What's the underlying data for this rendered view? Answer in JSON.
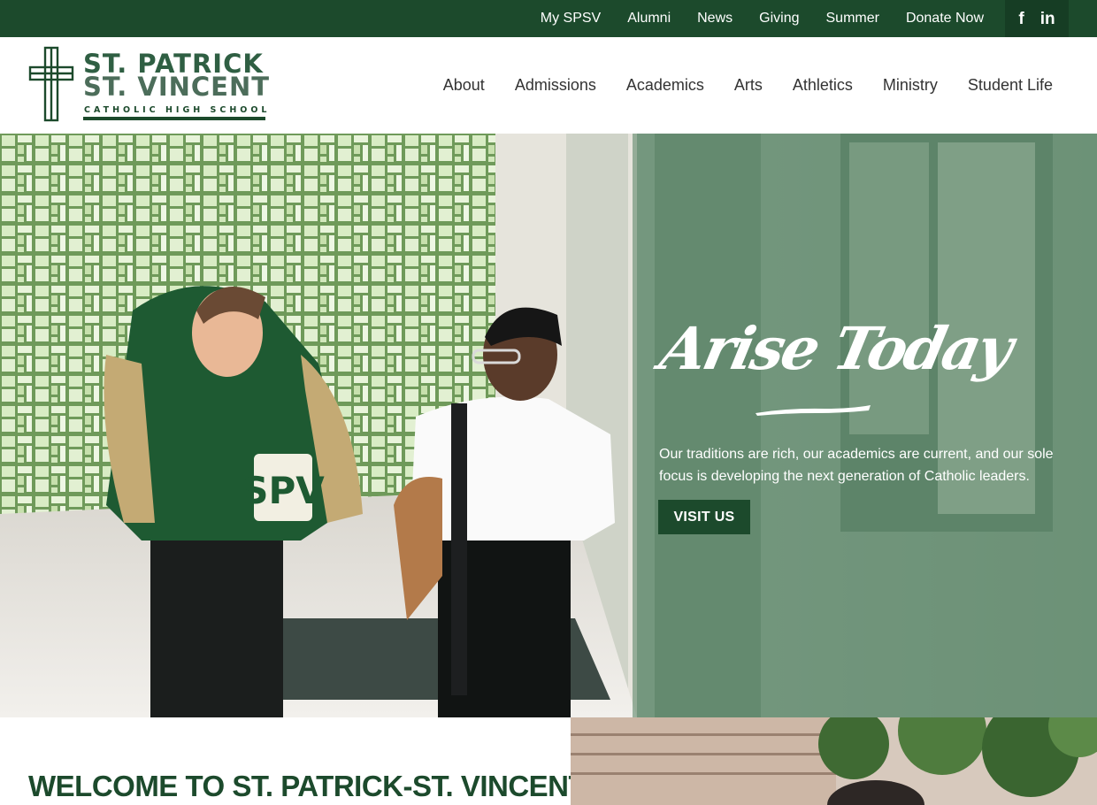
{
  "colors": {
    "brand_green": "#1c4a2c",
    "overlay_green": "#507d5f",
    "text_dark": "#333333"
  },
  "utility_nav": {
    "items": [
      {
        "label": "My SPSV"
      },
      {
        "label": "Alumni"
      },
      {
        "label": "News"
      },
      {
        "label": "Giving"
      },
      {
        "label": "Summer"
      },
      {
        "label": "Donate Now"
      }
    ],
    "social": [
      {
        "icon": "facebook-icon",
        "glyph": "f"
      },
      {
        "icon": "linkedin-icon",
        "glyph": "in"
      }
    ]
  },
  "logo": {
    "line1": "ST. PATRICK",
    "line2": "ST. VINCENT",
    "line3": "CATHOLIC HIGH SCHOOL",
    "icon": "cross-icon"
  },
  "main_nav": {
    "items": [
      {
        "label": "About"
      },
      {
        "label": "Admissions"
      },
      {
        "label": "Academics"
      },
      {
        "label": "Arts"
      },
      {
        "label": "Athletics"
      },
      {
        "label": "Ministry"
      },
      {
        "label": "Student Life"
      }
    ]
  },
  "hero": {
    "heading": "Arise Today",
    "text": "Our traditions are rich, our academics are current, and our sole focus is developing the next generation of Catholic leaders.",
    "button_label": "VISIT US",
    "jacket_letters": "SPV"
  },
  "welcome": {
    "title": "WELCOME TO ST. PATRICK-ST. VINCENT"
  }
}
